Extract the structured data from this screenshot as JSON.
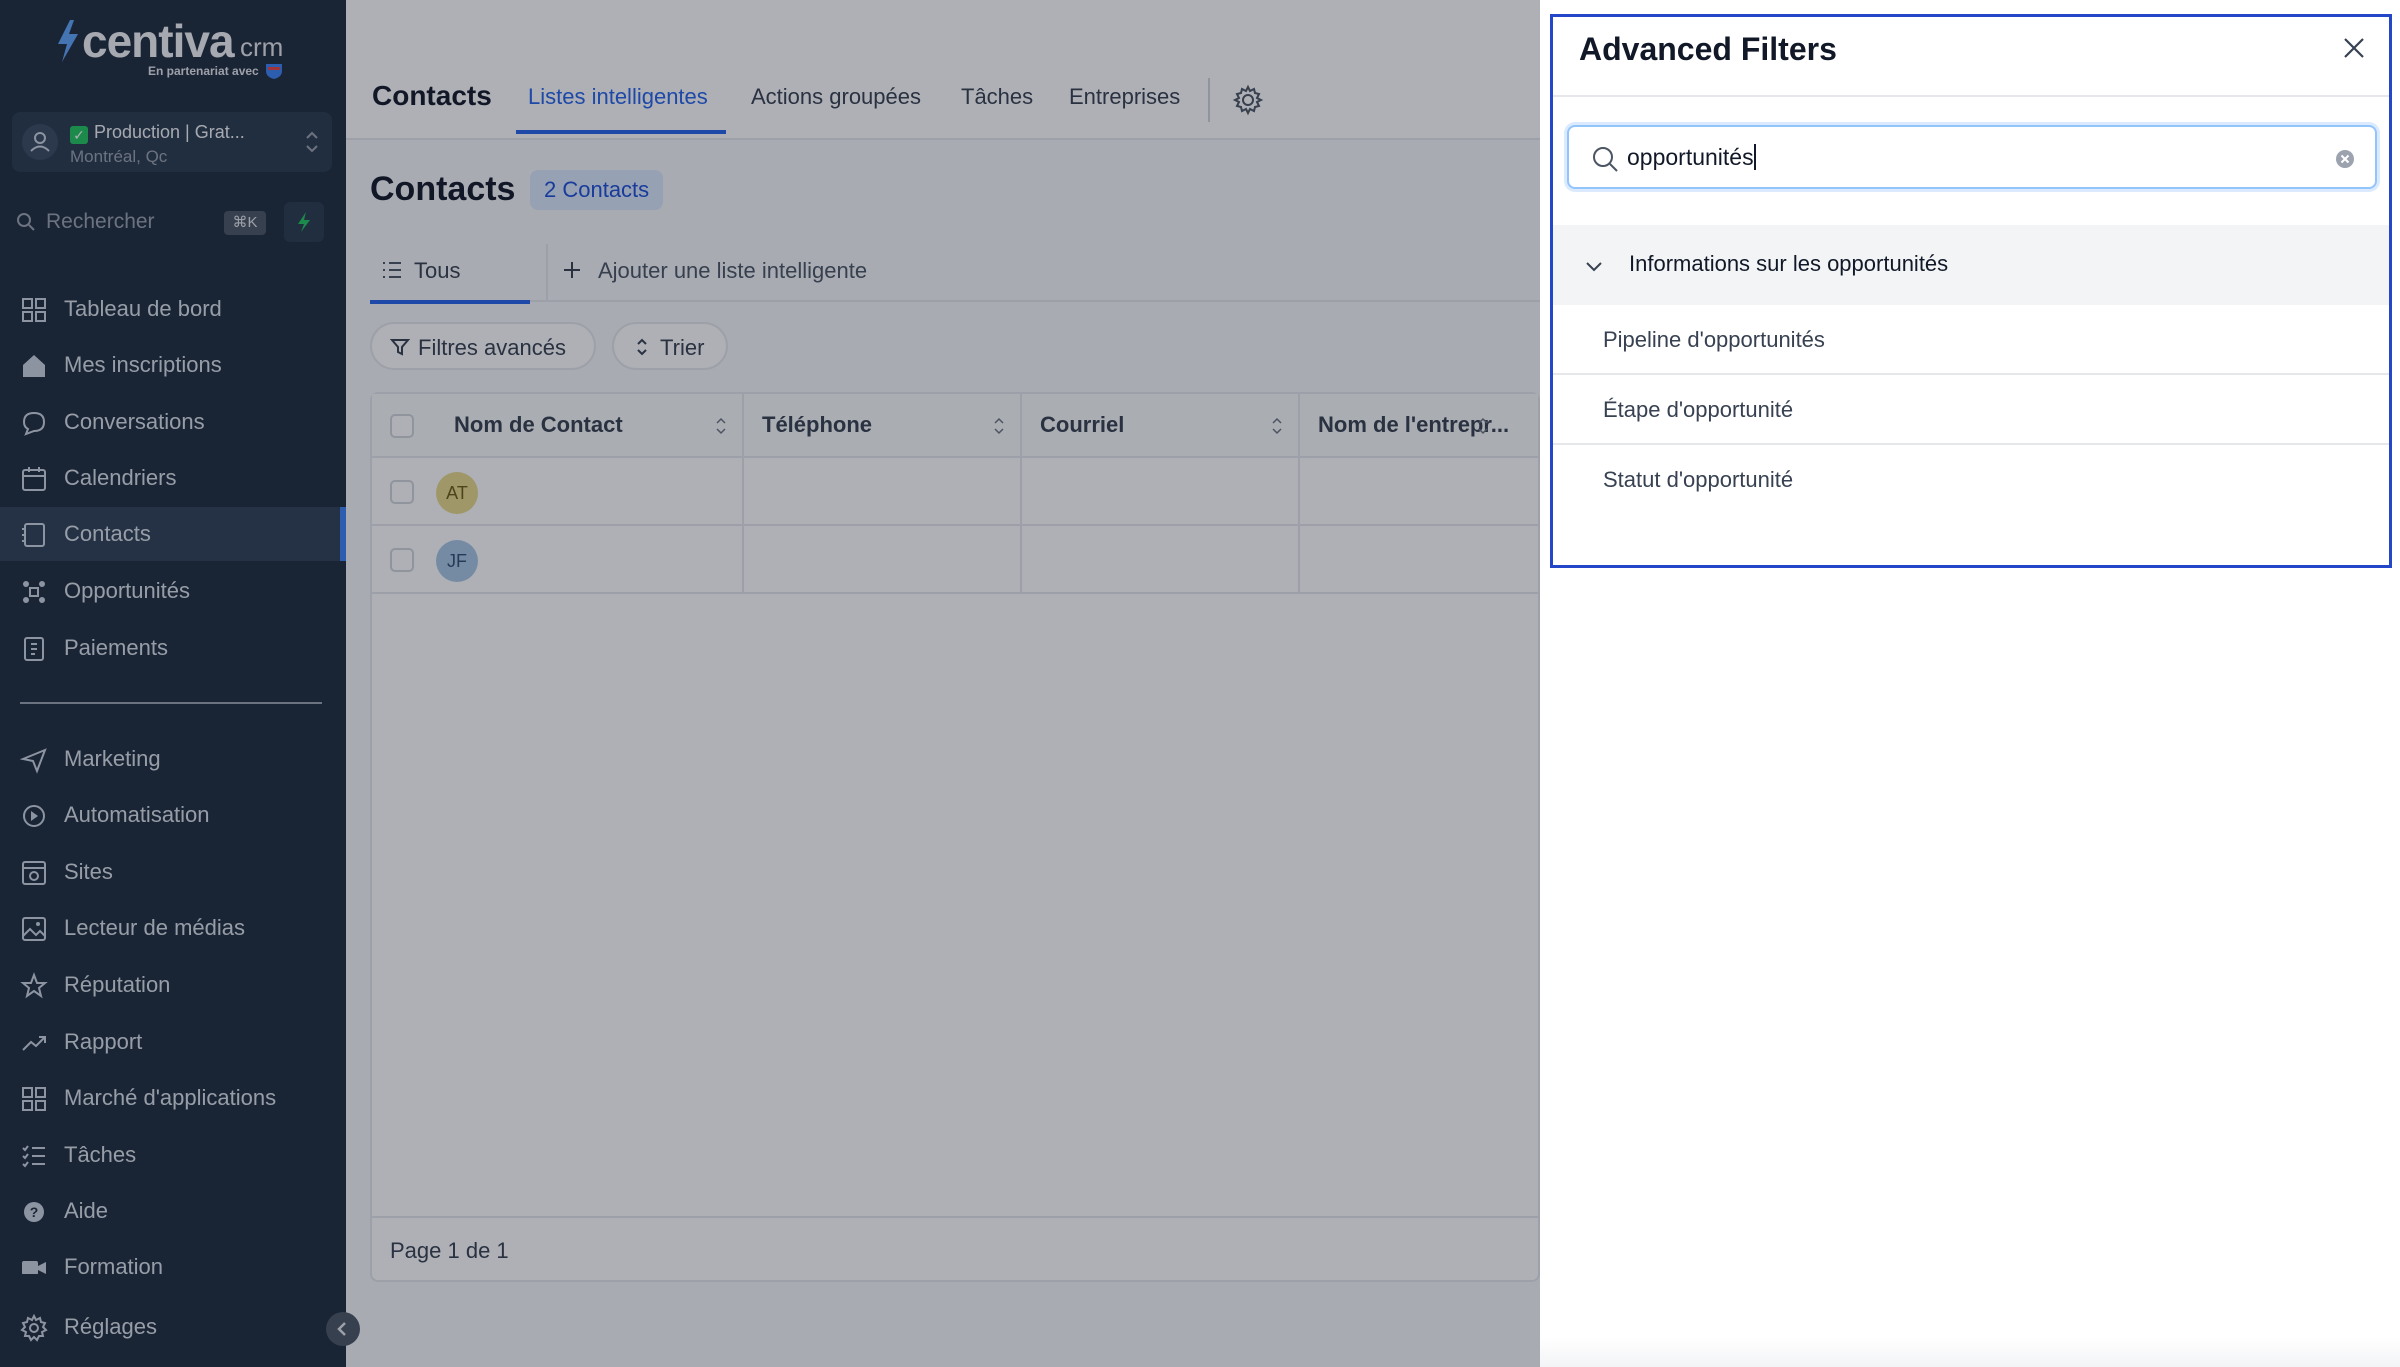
{
  "brand": {
    "logo_word": "centiva",
    "logo_suffix": "crm",
    "partner_text": "En partenariat avec",
    "accent_color": "#22c55e"
  },
  "account": {
    "name": "Production | Grat...",
    "location": "Montréal, Qc"
  },
  "search": {
    "placeholder": "Rechercher",
    "shortcut": "⌘K"
  },
  "sidebar": {
    "items": [
      {
        "label": "Tableau de bord",
        "icon": "dashboard-icon"
      },
      {
        "label": "Mes inscriptions",
        "icon": "home-icon"
      },
      {
        "label": "Conversations",
        "icon": "chat-icon"
      },
      {
        "label": "Calendriers",
        "icon": "calendar-icon"
      },
      {
        "label": "Contacts",
        "icon": "contacts-icon",
        "active": true
      },
      {
        "label": "Opportunités",
        "icon": "opportunities-icon"
      },
      {
        "label": "Paiements",
        "icon": "payments-icon"
      },
      {
        "label": "Marketing",
        "icon": "send-icon"
      },
      {
        "label": "Automatisation",
        "icon": "automation-icon"
      },
      {
        "label": "Sites",
        "icon": "sites-icon"
      },
      {
        "label": "Lecteur de médias",
        "icon": "media-icon"
      },
      {
        "label": "Réputation",
        "icon": "star-icon"
      },
      {
        "label": "Rapport",
        "icon": "trend-icon"
      },
      {
        "label": "Marché d'applications",
        "icon": "apps-icon"
      },
      {
        "label": "Tâches",
        "icon": "tasks-icon"
      },
      {
        "label": "Aide",
        "icon": "help-icon"
      },
      {
        "label": "Formation",
        "icon": "video-icon"
      },
      {
        "label": "Réglages",
        "icon": "settings-icon"
      }
    ]
  },
  "header": {
    "title": "Contacts",
    "tabs": [
      {
        "label": "Listes intelligentes",
        "active": true
      },
      {
        "label": "Actions groupées"
      },
      {
        "label": "Tâches"
      },
      {
        "label": "Entreprises"
      }
    ]
  },
  "main": {
    "title": "Contacts",
    "count": "2 Contacts",
    "list_tabs": {
      "all": "Tous",
      "add": "Ajouter une liste intelligente"
    },
    "filter_button": "Filtres avancés",
    "sort_button": "Trier",
    "table": {
      "columns": [
        "Nom de Contact",
        "Téléphone",
        "Courriel",
        "Nom de l'entrepr..."
      ],
      "rows": [
        {
          "initials": "AT",
          "color": "#e9d98a"
        },
        {
          "initials": "JF",
          "color": "#a9c7e6"
        }
      ]
    },
    "pagination": "Page 1 de 1"
  },
  "drawer": {
    "title": "Advanced Filters",
    "search_value": "opportunités",
    "group_label": "Informations sur les opportunités",
    "options": [
      "Pipeline d'opportunités",
      "Étape d'opportunité",
      "Statut d'opportunité"
    ],
    "highlight_color": "#2447c9"
  }
}
